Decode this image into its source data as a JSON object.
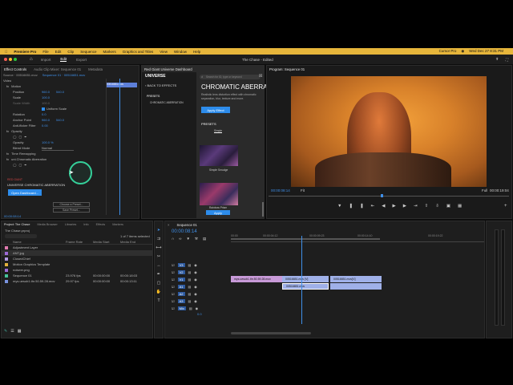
{
  "menubar": {
    "app": "Premiere Pro",
    "items": [
      "File",
      "Edit",
      "Clip",
      "Sequence",
      "Markers",
      "Graphics and Titles",
      "View",
      "Window",
      "Help"
    ],
    "status": "Cursor Pro",
    "datetime": "Wed Dec 27  8:31 PM"
  },
  "app_header": {
    "tabs": [
      "Import",
      "Edit",
      "Export"
    ],
    "active_tab": "Edit",
    "title": "The Chase - Edited"
  },
  "effect_controls": {
    "tabs": [
      "Effect Controls",
      "Audio Clip Mixer: Sequence 01",
      "Metadata"
    ],
    "source_label": "Source · 00516651.mov",
    "sequence_label": "Sequence 01 · 00516651.mov",
    "section_video": "Video",
    "section_motion": "Motion",
    "position_label": "Position",
    "position_x": "960.0",
    "position_y": "540.0",
    "scale_label": "Scale",
    "scale_value": "100.0",
    "scale_width_label": "Scale Width",
    "scale_width_value": "100.0",
    "uniform_scale_label": "Uniform Scale",
    "rotation_label": "Rotation",
    "rotation_value": "0.0",
    "anchor_label": "Anchor Point",
    "anchor_x": "960.0",
    "anchor_y": "540.0",
    "antiflicker_label": "Anti-flicker Filter",
    "antiflicker_value": "0.00",
    "opacity_section": "Opacity",
    "opacity_label": "Opacity",
    "opacity_value": "100.0 %",
    "blend_label": "Blend Mode",
    "blend_value": "Normal",
    "time_remap": "Time Remapping",
    "chromatic_effect": "uni.Chromatic Aberration",
    "universe_brand": "RED GIANT",
    "universe_product": "UNIVERSE CHROMATIC ABERRATION",
    "open_dashboard": "Open Dashboard...",
    "choose_preset": "Choose a Preset...",
    "save_preset": "Save Preset...",
    "timecode": "00:00:08:14",
    "mini_clip": "00516651.mov"
  },
  "universe_dashboard": {
    "panel_title": "Red Giant Universe Dashboard",
    "logo": "UNIVERSE",
    "back": "BACK TO EFFECTS",
    "search_placeholder": "Search for ID, type or keyword",
    "sidebar_presets": "PRESETS",
    "sidebar_item": "CHROMATIC ABERRATION",
    "effect_title": "CHROMATIC ABERRA...",
    "effect_desc": "Realistic lens distortion effect with chromatic separation, blur, texture and more.",
    "apply_effect": "Apply Effect",
    "presets_heading": "PRESETS",
    "preset_tab": "Simple",
    "preset_1": "Simple Smudge",
    "preset_2": "Rainbow Prism",
    "apply_btn": "Apply"
  },
  "program_monitor": {
    "title": "Program: Sequence 01",
    "timecode": "00:00:08:14",
    "fit": "Fit",
    "quality": "Full",
    "duration": "00:00:19:04"
  },
  "project": {
    "tabs": [
      "Project: The Chase",
      "Media Browser",
      "Libraries",
      "Info",
      "Effects",
      "Markers"
    ],
    "file": "The Chase.prproj",
    "items_selected": "1 of 7 items selected",
    "columns": [
      "Name",
      "Frame Rate",
      "Media Start",
      "Media End"
    ],
    "rows": [
      {
        "color": "#e07ab0",
        "name": "Adjustment Layer",
        "fps": "",
        "start": "",
        "end": ""
      },
      {
        "color": "#9d6ad8",
        "name": "ANT.jpg",
        "fps": "",
        "start": "",
        "end": ""
      },
      {
        "color": "#b19ae0",
        "name": "ClosedChief",
        "fps": "",
        "start": "",
        "end": ""
      },
      {
        "color": "#e3b13c",
        "name": "Motion Graphics Template",
        "fps": "",
        "start": "",
        "end": ""
      },
      {
        "color": "#9d6ad8",
        "name": "noiseer.png",
        "fps": "",
        "start": "",
        "end": ""
      },
      {
        "color": "#46c29a",
        "name": "Sequence 01",
        "fps": "23.976 fps",
        "start": "00:00:00:00",
        "end": "00:00:18:03"
      },
      {
        "color": "#7a94e0",
        "name": "mys.uesub1.thr.50.59.28.mov",
        "fps": "29.97 fps",
        "start": "00:00:00:00",
        "end": "00:00:13:11"
      }
    ]
  },
  "timeline": {
    "title": "Sequence 01",
    "timecode": "00:00:08:14",
    "ruler": [
      "00:00",
      "00:00:04:12",
      "00:00:09:23",
      "00:00:14:10",
      "00:00:19:22"
    ],
    "tracks": [
      "V3",
      "V2",
      "V1",
      "A1",
      "A2",
      "A3",
      "Mix"
    ],
    "clips": [
      {
        "label": "mys.uesub1.thr.50.59.28.mov",
        "color": "#c89ad8"
      },
      {
        "label": "00516651.mov [V]",
        "color": "#9fb0e8"
      },
      {
        "label": "00516651.mov",
        "color": "#9fb0e8"
      },
      {
        "label": "00516651.mov[V]",
        "color": "#9fb0e8"
      }
    ],
    "mix_value": "0.0"
  }
}
